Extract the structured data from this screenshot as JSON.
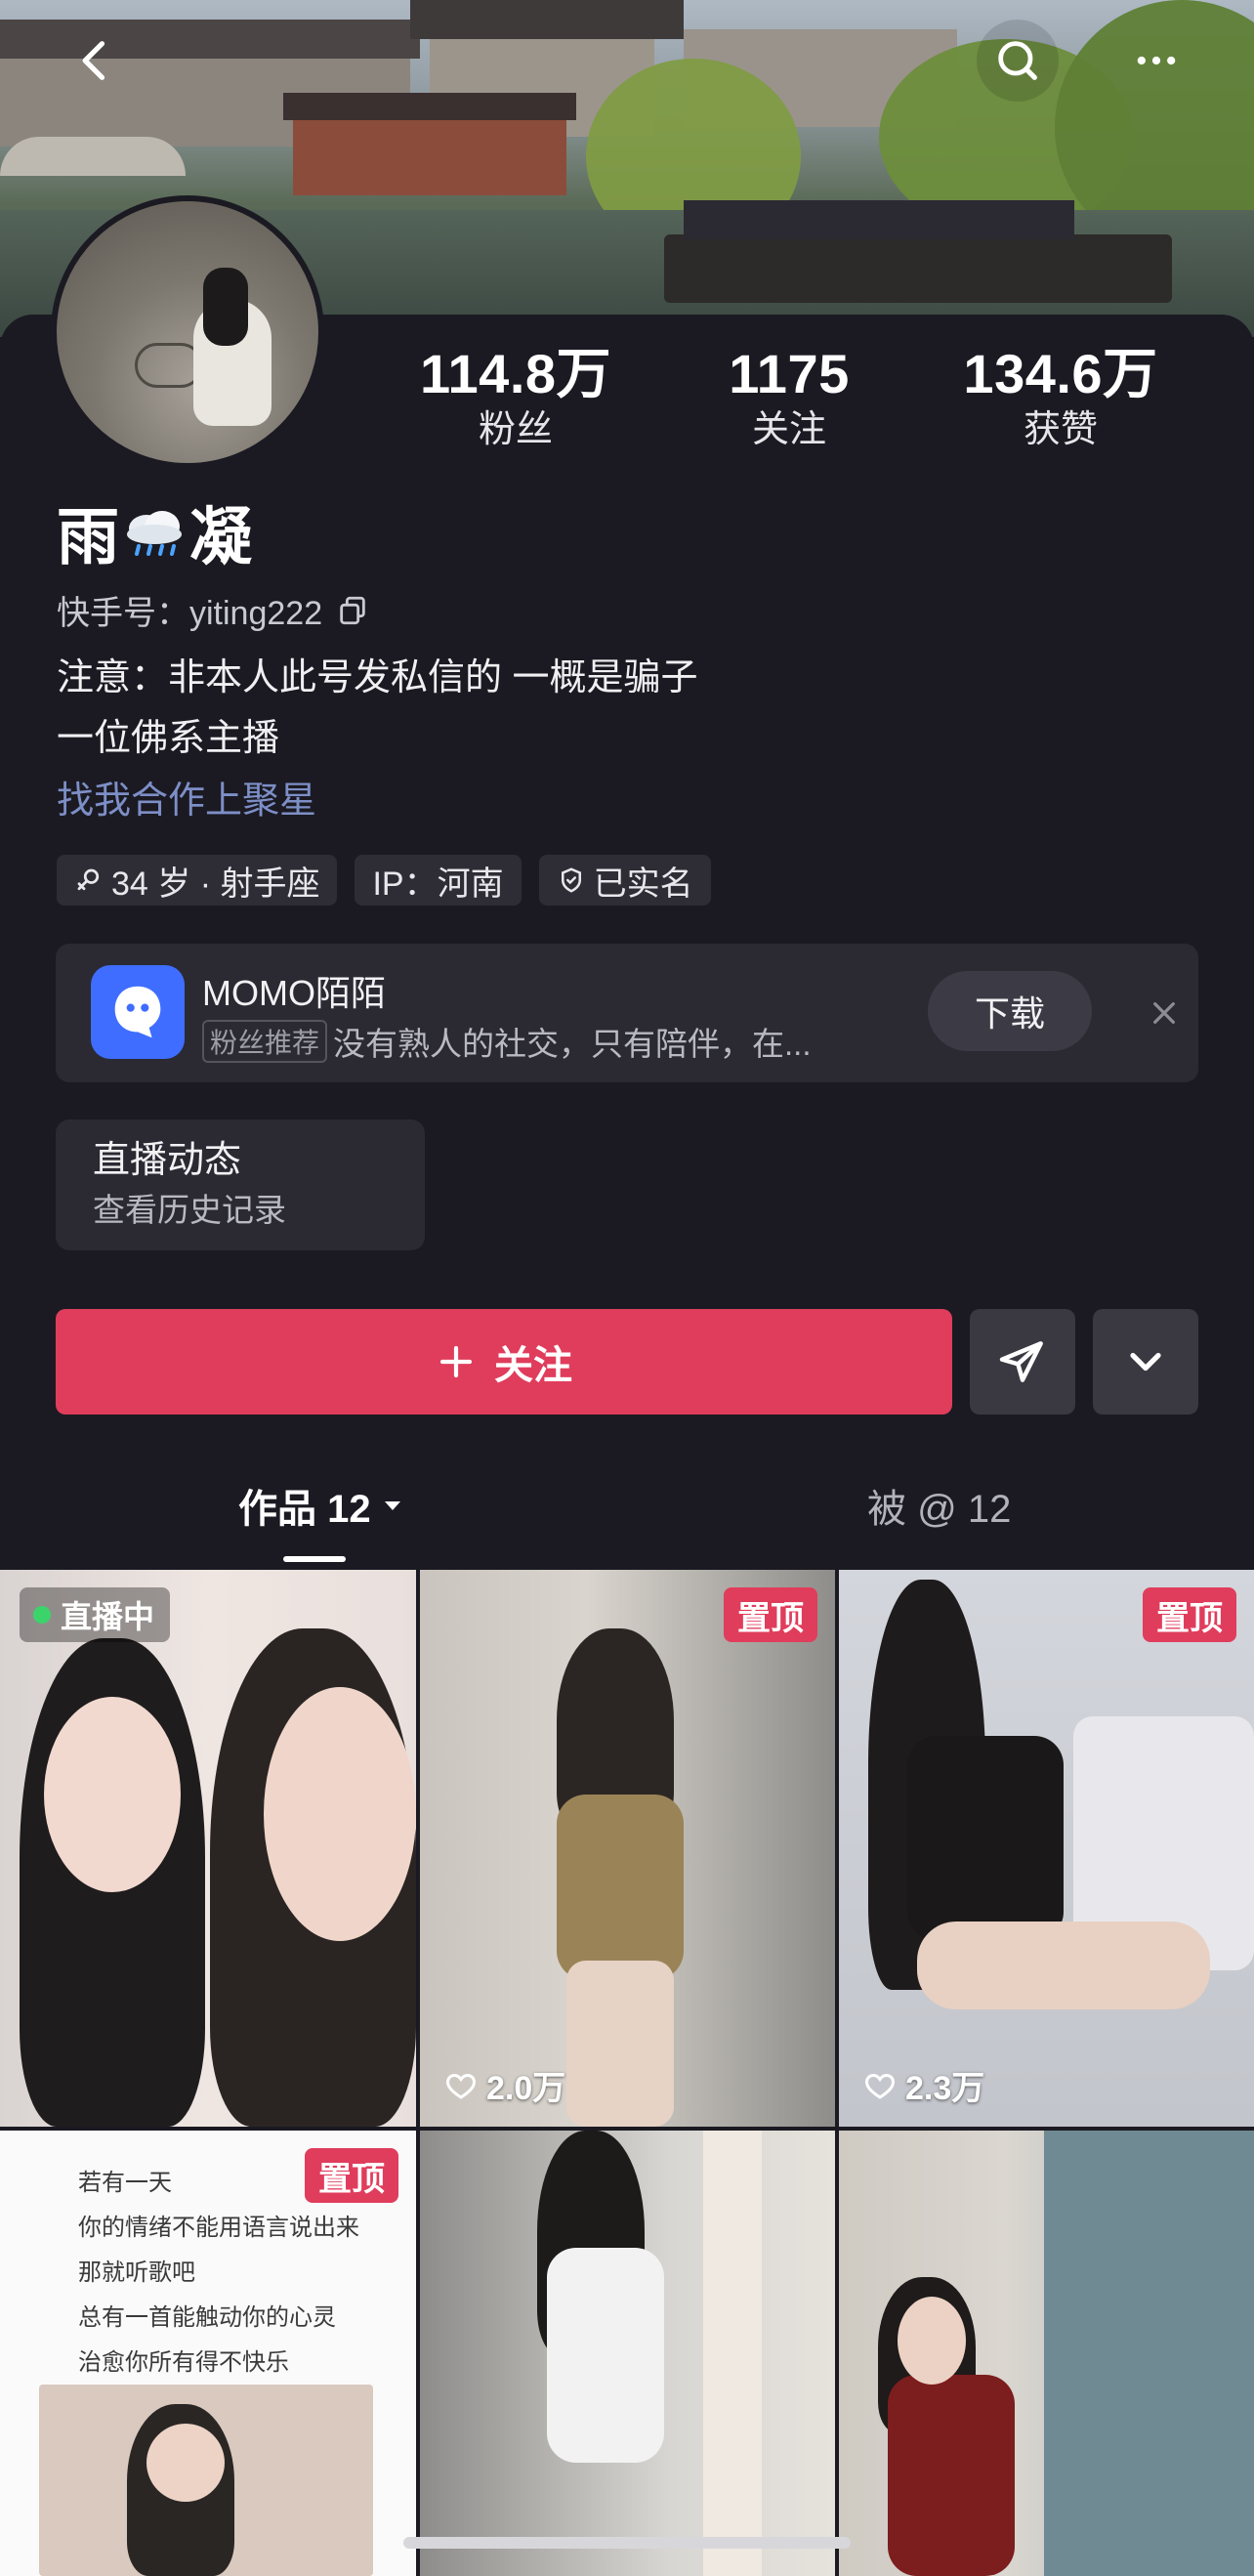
{
  "header": {
    "back_icon": "chevron-left-icon",
    "search_icon": "search-icon",
    "more_icon": "more-dots-icon"
  },
  "profile": {
    "name": "雨",
    "name_suffix": "凝",
    "name_emoji_icon": "rain-cloud-icon",
    "id_label": "快手号：yiting222",
    "stats": [
      {
        "value": "114.8万",
        "label": "粉丝"
      },
      {
        "value": "1175",
        "label": "关注"
      },
      {
        "value": "134.6万",
        "label": "获赞"
      }
    ],
    "bio_lines": [
      "注意：非本人此号发私信的 一概是骗子",
      "一位佛系主播"
    ],
    "bio_link": "找我合作上聚星",
    "tags": [
      "34 岁 · 射手座",
      "IP：河南",
      "已实名"
    ]
  },
  "ad": {
    "title": "MOMO陌陌",
    "badge": "粉丝推荐",
    "desc": "没有熟人的社交，只有陪伴，在...",
    "download": "下载"
  },
  "live_card": {
    "title": "直播动态",
    "subtitle": "查看历史记录"
  },
  "actions": {
    "follow": "关注"
  },
  "tabs": [
    {
      "label": "作品 12",
      "active": true
    },
    {
      "label": "被 @ 12",
      "active": false
    }
  ],
  "grid": {
    "live_badge": "直播中",
    "pinned_label": "置顶",
    "likes": [
      "2.0万",
      "2.3万"
    ],
    "poem_lines": [
      "若有一天",
      "你的情绪不能用语言说出来",
      "那就听歌吧",
      "总有一首能触动你的心灵",
      "治愈你所有得不快乐"
    ]
  },
  "colors": {
    "accent": "#e03d5c",
    "background": "#1b1a22",
    "link": "#7d8fc7"
  }
}
